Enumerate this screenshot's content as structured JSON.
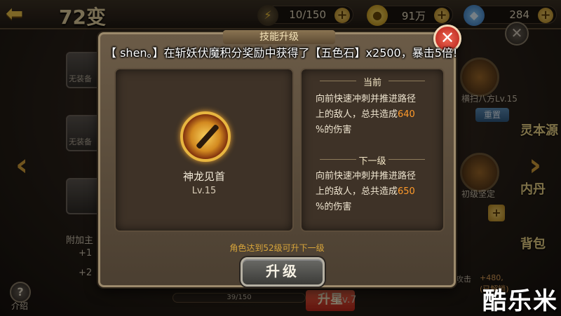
{
  "header": {
    "title": "72变",
    "resources": {
      "energy": "10/150",
      "coins": "91万",
      "gems": "284"
    }
  },
  "left_column": {
    "slot_labels": [
      "无装备",
      "无装备"
    ],
    "bonus_label": "附加主",
    "stats": [
      "+1",
      "+2"
    ],
    "help_label": "介绍"
  },
  "right_column": {
    "skill_label_1": "横扫八方Lv.15",
    "reset_label": "重置",
    "skill_label_2": "初级坚定",
    "tab_1": "灵本源",
    "tab_2": "内丹",
    "tab_3": "背包",
    "bonus_value": "+480,",
    "bonus_status": "(已解锁)",
    "bonus_prefix": "攻击"
  },
  "bottom_bar": {
    "progress": "39/150",
    "level_label": "Lv.7",
    "upgrade_label": "升星"
  },
  "modal": {
    "title": "技能升级",
    "skill": {
      "name": "神龙见首",
      "level": "Lv.15"
    },
    "current": {
      "heading": "当前",
      "line1": "向前快速冲刺并推进路径",
      "line2_prefix": "上的敌人，总共造成",
      "value": "640",
      "line3_suffix": "%的伤害"
    },
    "next": {
      "heading": "下一级",
      "line1": "向前快速冲刺并推进路径",
      "line2_prefix": "上的敌人，总共造成",
      "value": "650",
      "line3_suffix": "%的伤害"
    },
    "requirement": "角色达到52级可升下一级",
    "upgrade_button": "升级"
  },
  "broadcast": "【 shen。】在斩妖伏魔积分奖励中获得了【五色石】x2500，暴击5倍!",
  "watermark": "酷乐米",
  "colors": {
    "accent_gold": "#f0c64a",
    "highlight_orange": "#ff9a2a",
    "close_red": "#c8281c"
  }
}
